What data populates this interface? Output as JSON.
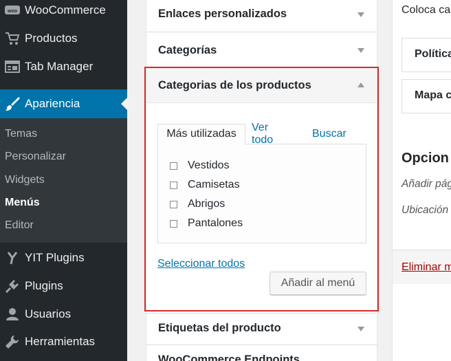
{
  "sidebar": {
    "items": [
      {
        "label": "WooCommerce",
        "icon": "woocommerce-icon"
      },
      {
        "label": "Productos",
        "icon": "cart-icon"
      },
      {
        "label": "Tab Manager",
        "icon": "tab-manager-icon"
      },
      {
        "label": "Apariencia",
        "icon": "brush-icon"
      },
      {
        "label": "YIT Plugins",
        "icon": "yit-icon"
      },
      {
        "label": "Plugins",
        "icon": "plugin-icon"
      },
      {
        "label": "Usuarios",
        "icon": "user-icon"
      },
      {
        "label": "Herramientas",
        "icon": "wrench-icon"
      }
    ],
    "submenu": [
      "Temas",
      "Personalizar",
      "Widgets",
      "Menús",
      "Editor"
    ],
    "current_submenu": "Menús"
  },
  "accordion": {
    "custom_links": "Enlaces personalizados",
    "categories": "Categorías",
    "product_categories": "Categorias de los productos",
    "product_tags": "Etiquetas del producto",
    "next_partial": "WooCommerce Endpoints"
  },
  "panel": {
    "tabs": [
      "Más utilizadas",
      "Ver todo",
      "Buscar"
    ],
    "active_tab": "Más utilizadas",
    "items": [
      "Vestidos",
      "Camisetas",
      "Abrigos",
      "Pantalones"
    ],
    "select_all": "Seleccionar todos",
    "add_button": "Añadir al menú"
  },
  "right": {
    "intro": "Coloca ca",
    "box1": "Política",
    "box2": "Mapa c",
    "options_heading": "Opcion",
    "add_pages": "Añadir pág",
    "location": "Ubicación",
    "delete": "Eliminar m"
  },
  "colors": {
    "admin_bar": "#23282d",
    "accent": "#0073aa",
    "highlight": "#d32a2a"
  }
}
